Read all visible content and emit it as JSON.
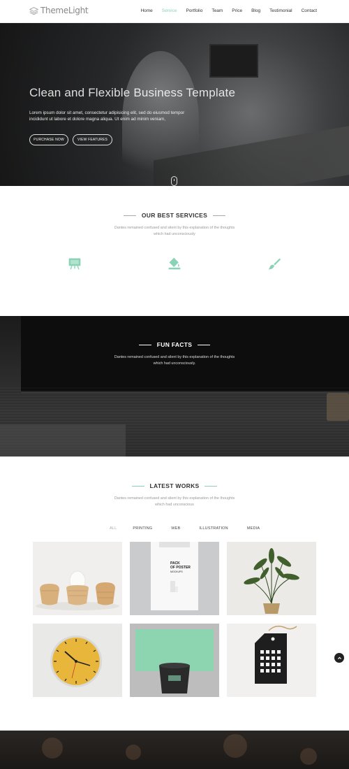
{
  "brand": {
    "logo_text": "ThemeLight"
  },
  "nav": {
    "items": [
      "Home",
      "Service",
      "Portfolio",
      "Team",
      "Price",
      "Blog",
      "Testimonial",
      "Contact"
    ],
    "active": "Service"
  },
  "hero": {
    "title": "Clean and Flexible Business Template",
    "description": "Lorem ipsum dolor sit amet, consectetur adipisicing elit, sed do eiusmod tempor incididunt ut labore et dolore magna aliqua. Ut enim ad minim veniam,",
    "purchase_label": "PURCHASE NOW",
    "view_label": "VIEW FEATURES"
  },
  "services": {
    "title": "OUR BEST SERVICES",
    "description": "Dantes remained confused and silent by this explanation of the thoughts which had unconsciously",
    "icons": [
      "easel-icon",
      "paint-bucket-icon",
      "paintbrush-icon"
    ]
  },
  "funfacts": {
    "title": "FUN FACTS",
    "description": "Dantes remained confused and silent by this explanation of the thoughts which had unconsciously."
  },
  "works": {
    "title": "LATEST WORKS",
    "description": "Dantes remained confused and silent by this explanation of the thoughts which had unconscious",
    "filters": [
      "ALL",
      "PRINTING",
      "WEB",
      "ILLUSTRATION",
      "MEDIA"
    ],
    "active_filter": "ALL",
    "poster_text": [
      "PACK",
      "OF POSTER",
      "MOCKUPS"
    ]
  },
  "colors": {
    "accent": "#8ad3b6",
    "dark": "#222222",
    "text": "#333333"
  }
}
